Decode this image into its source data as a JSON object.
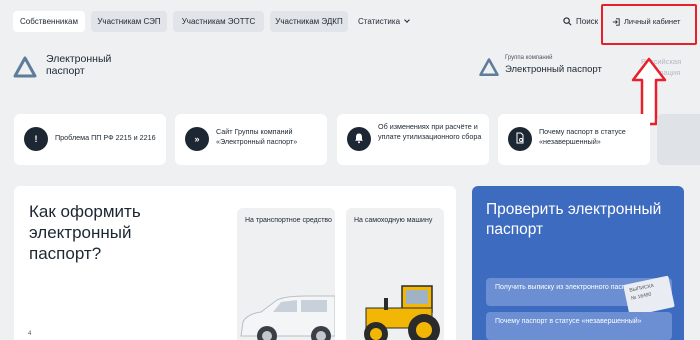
{
  "nav": {
    "tabs": [
      {
        "label": "Собственникам",
        "active": true
      },
      {
        "label": "Участникам СЭП",
        "active": false
      },
      {
        "label": "Участникам ЭОТТС",
        "active": false
      },
      {
        "label": "Участникам ЭДКП",
        "active": false
      }
    ],
    "statistics_label": "Статистика",
    "search_label": "Поиск",
    "cabinet_label": "Личный кабинет"
  },
  "logo": {
    "left_line1": "Электронный",
    "left_line2": "паспорт",
    "right_group": "Группа компаний",
    "right_name": "Электронный паспорт",
    "faded_line1": "Российская",
    "faded_line2": "Федерация"
  },
  "info_cards": [
    {
      "icon": "info-icon",
      "text": "Проблема ПП РФ 2215 и 2216"
    },
    {
      "icon": "double-chevron-icon",
      "text": "Сайт Группы компаний «Электронный паспорт»"
    },
    {
      "icon": "bell-icon",
      "text": "Об изменениях при расчёте и уплате утилизационного сбора"
    },
    {
      "icon": "document-search-icon",
      "text": "Почему паспорт в статусе «незавершенный»"
    }
  ],
  "howto": {
    "title": "Как оформить электронный паспорт?",
    "number": "4",
    "cards": [
      {
        "text": "На транспортное средство",
        "image": "car-image"
      },
      {
        "text": "На самоходную машину",
        "image": "tractor-image"
      }
    ]
  },
  "check": {
    "title": "Проверить электронный паспорт",
    "buttons": [
      {
        "text": "Получить выписку из электронного паспорта"
      },
      {
        "text": "Почему паспорт в статусе «незавершенный»"
      }
    ],
    "doc_snippet_line1": "ВЫПИСКА",
    "doc_snippet_line2": "№ 16490"
  },
  "colors": {
    "accent_blue": "#3d6bc0",
    "highlight_red": "#e8202b",
    "dark": "#1d2733",
    "background": "#eef0f2"
  }
}
